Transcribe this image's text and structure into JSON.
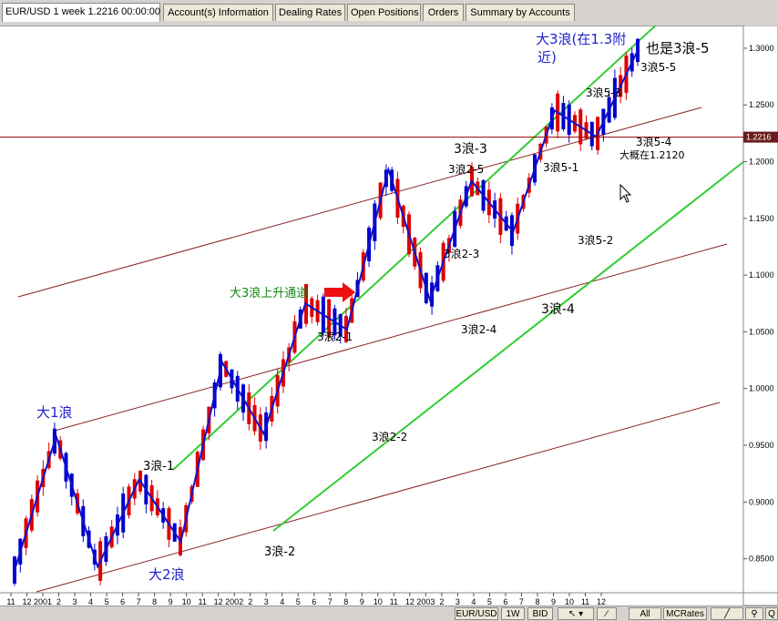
{
  "tabs": [
    {
      "label": "EUR/USD 1 week 1.2216 00:00:00",
      "active": true
    },
    {
      "label": "Account(s) Information",
      "active": false
    },
    {
      "label": "Dealing Rates",
      "active": false
    },
    {
      "label": "Open Positions",
      "active": false
    },
    {
      "label": "Orders",
      "active": false
    },
    {
      "label": "Summary by Accounts",
      "active": false
    }
  ],
  "bottom": {
    "symbol": "EUR/USD",
    "period": "1W",
    "side": "BID",
    "all": "All",
    "mcrates": "MCRates"
  },
  "colors": {
    "bull": "#0000cc",
    "bear": "#dd0000",
    "wave": "#1111cc",
    "channel": "#33cc33",
    "trend": "#882222",
    "price_line": "#990000",
    "annot_blue": "#2222cc",
    "annot_green": "#118811"
  },
  "chart_data": {
    "type": "candlestick",
    "symbol": "EUR/USD",
    "timeframe": "1 week",
    "last_price": "1.2216",
    "ylim": [
      0.82,
      1.32
    ],
    "y_ticks": [
      "1.3000",
      "1.2500",
      "1.2000",
      "1.1500",
      "1.1000",
      "1.0500",
      "1.0000",
      "0.9500",
      "0.9000",
      "0.8500"
    ],
    "x_ticks": [
      "11",
      "12",
      "2001",
      "2",
      "3",
      "4",
      "5",
      "6",
      "7",
      "8",
      "9",
      "10",
      "11",
      "12",
      "2002",
      "2",
      "3",
      "4",
      "5",
      "6",
      "7",
      "8",
      "9",
      "10",
      "11",
      "12",
      "2003",
      "2",
      "3",
      "4",
      "5",
      "6",
      "7",
      "8",
      "9",
      "10",
      "11",
      "12"
    ],
    "wave_path": [
      [
        0.84,
        0.84
      ],
      [
        0.958,
        0.958
      ],
      [
        0.843,
        0.843
      ],
      [
        0.92,
        0.92
      ],
      [
        0.865,
        0.865
      ],
      [
        1.023,
        1.023
      ],
      [
        0.96,
        0.96
      ],
      [
        1.075,
        1.075
      ],
      [
        1.052,
        1.052
      ],
      [
        1.193,
        1.193
      ],
      [
        1.078,
        1.078
      ],
      [
        1.183,
        1.183
      ],
      [
        1.138,
        1.138
      ],
      [
        1.245,
        1.245
      ],
      [
        1.222,
        1.222
      ],
      [
        1.298,
        1.298
      ]
    ],
    "annotations": [
      {
        "text": "大1浪",
        "color": "blue"
      },
      {
        "text": "大2浪",
        "color": "blue"
      },
      {
        "text": "3浪-1",
        "color": "black"
      },
      {
        "text": "3浪-2",
        "color": "black"
      },
      {
        "text": "3浪2-1",
        "color": "black"
      },
      {
        "text": "3浪2-2",
        "color": "black"
      },
      {
        "text": "3浪2-3",
        "color": "black"
      },
      {
        "text": "3浪2-4",
        "color": "black"
      },
      {
        "text": "3浪2-5",
        "color": "black"
      },
      {
        "text": "3浪-3",
        "color": "black"
      },
      {
        "text": "3浪-4",
        "color": "black"
      },
      {
        "text": "3浪5-1",
        "color": "black"
      },
      {
        "text": "3浪5-2",
        "color": "black"
      },
      {
        "text": "3浪5-3",
        "color": "black"
      },
      {
        "text": "3浪5-4",
        "color": "black"
      },
      {
        "text": "大概在1.2120",
        "color": "black"
      },
      {
        "text": "3浪5-5",
        "color": "black"
      },
      {
        "text": "也是3浪-5",
        "color": "black"
      },
      {
        "text": "大3浪(在1.3附",
        "color": "blue"
      },
      {
        "text": "近)",
        "color": "blue"
      },
      {
        "text": "大3浪上升通道",
        "color": "green"
      }
    ]
  }
}
